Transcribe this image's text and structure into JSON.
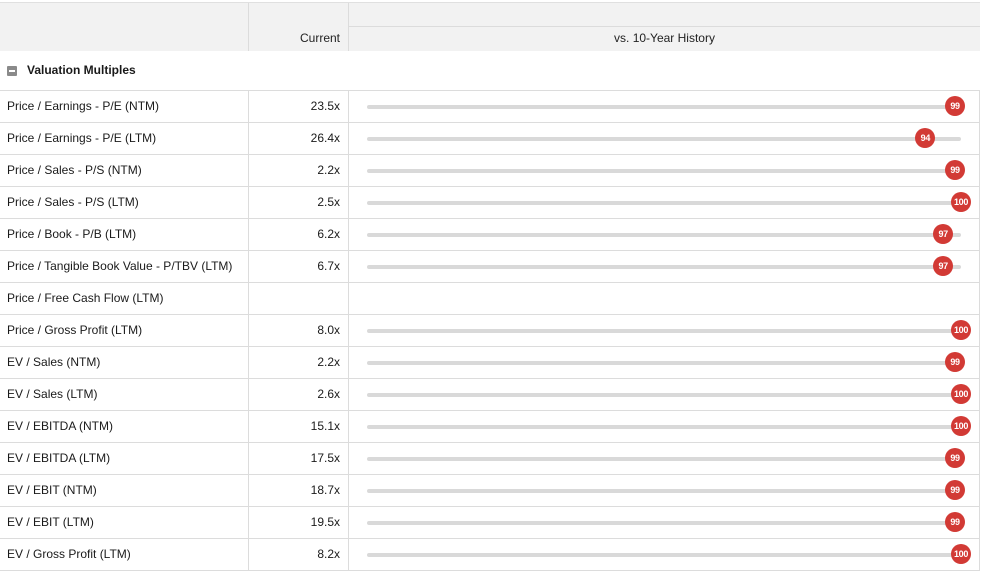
{
  "header": {
    "current_label": "Current",
    "history_label": "vs. 10-Year History"
  },
  "section": {
    "title": "Valuation Multiples",
    "toggle_icon": "collapse-minus-icon"
  },
  "colors": {
    "marker": "#d23a35",
    "track": "#d9d9d9"
  },
  "rows": [
    {
      "label": "Price / Earnings - P/E (NTM)",
      "current": "23.5x",
      "percentile": "99"
    },
    {
      "label": "Price / Earnings - P/E (LTM)",
      "current": "26.4x",
      "percentile": "94"
    },
    {
      "label": "Price / Sales - P/S (NTM)",
      "current": "2.2x",
      "percentile": "99"
    },
    {
      "label": "Price / Sales - P/S (LTM)",
      "current": "2.5x",
      "percentile": "100"
    },
    {
      "label": "Price / Book - P/B (LTM)",
      "current": "6.2x",
      "percentile": "97"
    },
    {
      "label": "Price / Tangible Book Value - P/TBV (LTM)",
      "current": "6.7x",
      "percentile": "97"
    },
    {
      "label": "Price / Free Cash Flow (LTM)",
      "current": "",
      "percentile": ""
    },
    {
      "label": "Price / Gross Profit (LTM)",
      "current": "8.0x",
      "percentile": "100"
    },
    {
      "label": "EV / Sales (NTM)",
      "current": "2.2x",
      "percentile": "99"
    },
    {
      "label": "EV / Sales (LTM)",
      "current": "2.6x",
      "percentile": "100"
    },
    {
      "label": "EV / EBITDA (NTM)",
      "current": "15.1x",
      "percentile": "100"
    },
    {
      "label": "EV / EBITDA (LTM)",
      "current": "17.5x",
      "percentile": "99"
    },
    {
      "label": "EV / EBIT (NTM)",
      "current": "18.7x",
      "percentile": "99"
    },
    {
      "label": "EV / EBIT (LTM)",
      "current": "19.5x",
      "percentile": "99"
    },
    {
      "label": "EV / Gross Profit (LTM)",
      "current": "8.2x",
      "percentile": "100"
    }
  ]
}
